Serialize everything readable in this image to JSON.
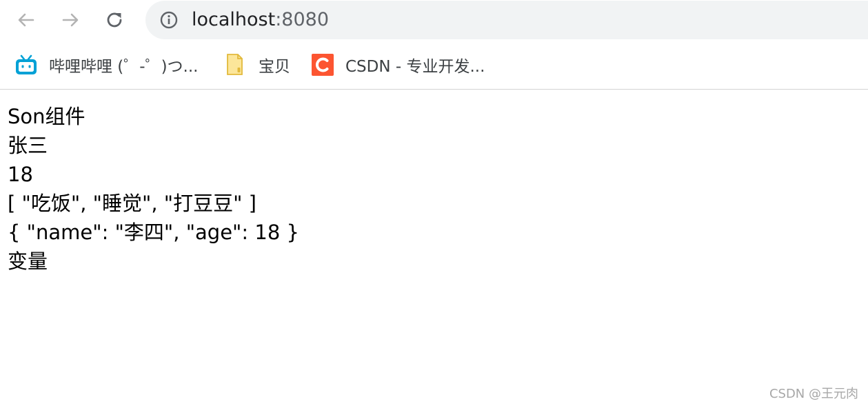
{
  "browser": {
    "address_host": "localhost",
    "address_port": ":8080",
    "nav_icons": [
      "back-arrow-icon",
      "forward-arrow-icon",
      "reload-icon",
      "info-icon"
    ]
  },
  "bookmarks": [
    {
      "label": "哔哩哔哩 (゜-゜)つ...",
      "icon": "bilibili-icon",
      "color": "#00a1d6"
    },
    {
      "label": "宝贝",
      "icon": "folder-icon",
      "color": "#f7d56a"
    },
    {
      "label": "CSDN - 专业开发...",
      "icon": "csdn-icon",
      "color": "#fc5531"
    }
  ],
  "page": {
    "lines": [
      "Son组件",
      "张三",
      "18",
      "[ \"吃饭\", \"睡觉\", \"打豆豆\" ]",
      "{ \"name\": \"李四\", \"age\": 18 }",
      "变量"
    ]
  },
  "watermark": "CSDN @王元肉"
}
